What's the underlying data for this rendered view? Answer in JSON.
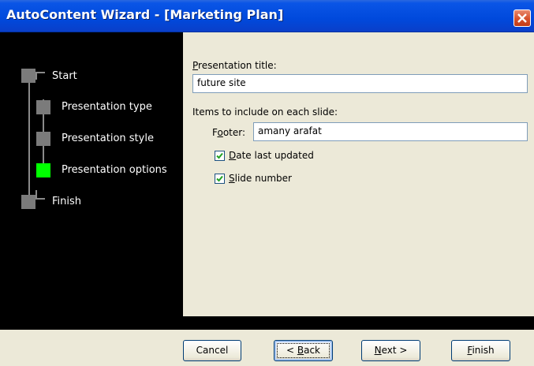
{
  "window": {
    "title": "AutoContent Wizard - [Marketing Plan]"
  },
  "steps": [
    {
      "label": "Start",
      "active": false
    },
    {
      "label": "Presentation type",
      "active": false
    },
    {
      "label": "Presentation style",
      "active": false
    },
    {
      "label": "Presentation options",
      "active": true
    },
    {
      "label": "Finish",
      "active": false
    }
  ],
  "form": {
    "title_label_mnemonic": "P",
    "title_label_rest": "resentation title:",
    "title_value": "future site",
    "items_label": "Items to include on each slide:",
    "footer_label_pre": "F",
    "footer_label_mnemonic": "o",
    "footer_label_rest": "oter:",
    "footer_value": "amany arafat",
    "date_mnemonic": "D",
    "date_rest": "ate last updated",
    "date_checked": true,
    "slide_mnemonic": "S",
    "slide_rest": "lide number",
    "slide_checked": true
  },
  "buttons": {
    "cancel": "Cancel",
    "back_pre": "< ",
    "back_mnemonic": "B",
    "back_rest": "ack",
    "next_mnemonic": "N",
    "next_rest": "ext >",
    "finish_mnemonic": "F",
    "finish_rest": "inish"
  },
  "colors": {
    "active_step": "#00ff00",
    "inactive_step": "#7b7b7b",
    "titlebar": "#0049dc"
  }
}
